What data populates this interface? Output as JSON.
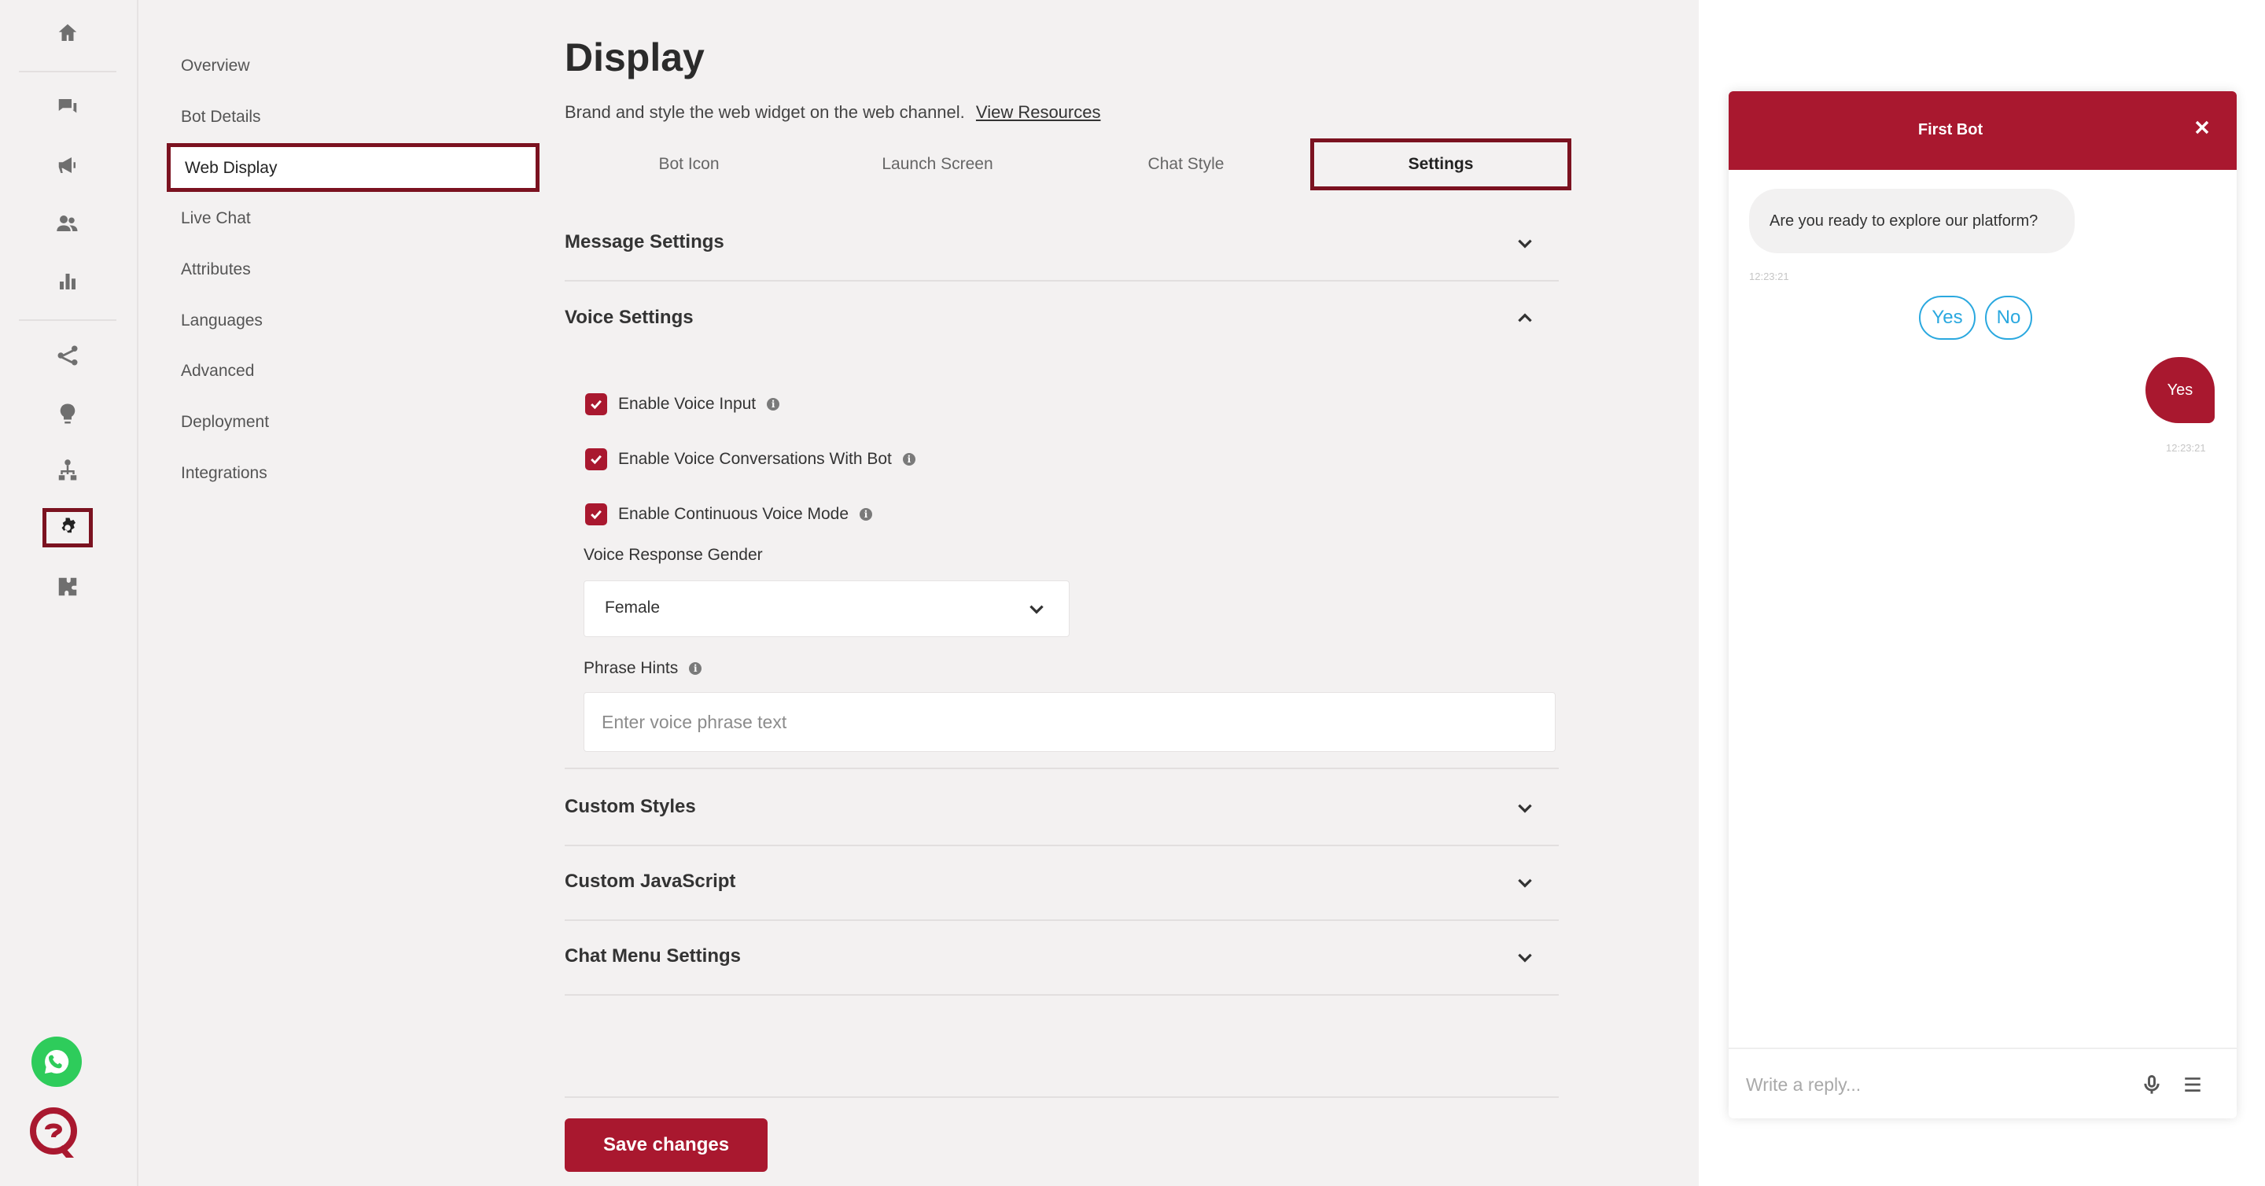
{
  "rail": {
    "icons": [
      "home-icon",
      "chat-icon",
      "megaphone-icon",
      "users-icon",
      "bar-chart-icon",
      "flow-icon",
      "lightbulb-icon",
      "hierarchy-icon",
      "gear-icon",
      "puzzle-icon"
    ],
    "active": "gear-icon"
  },
  "subnav": {
    "items": [
      "Overview",
      "Bot Details",
      "Web Display",
      "Live Chat",
      "Attributes",
      "Languages",
      "Advanced",
      "Deployment",
      "Integrations"
    ],
    "active": "Web Display"
  },
  "page": {
    "title": "Display",
    "subtitle": "Brand and style the web widget on the web channel.",
    "resources_link": "View Resources"
  },
  "tabs": [
    "Bot Icon",
    "Launch Screen",
    "Chat Style",
    "Settings"
  ],
  "active_tab": "Settings",
  "sections": {
    "message": "Message Settings",
    "voice": "Voice Settings",
    "custom_styles": "Custom Styles",
    "custom_js": "Custom JavaScript",
    "chat_menu": "Chat Menu Settings"
  },
  "voice": {
    "enable_voice_input": "Enable Voice Input",
    "enable_voice_conversations": "Enable Voice Conversations With Bot",
    "enable_continuous": "Enable Continuous Voice Mode",
    "gender_label": "Voice Response Gender",
    "gender_value": "Female",
    "phrase_label": "Phrase Hints",
    "phrase_placeholder": "Enter voice phrase text"
  },
  "save_label": "Save changes",
  "preview": {
    "title": "First Bot",
    "bot_message": "Are you ready to explore our platform?",
    "bot_time": "12:23:21",
    "quick_replies": [
      "Yes",
      "No"
    ],
    "user_message": "Yes",
    "user_time": "12:23:21",
    "input_placeholder": "Write a reply..."
  },
  "colors": {
    "brand": "#a9182f",
    "highlight_border": "#7b1220",
    "quick_reply": "#2aa8df",
    "whatsapp": "#2ecc5b"
  }
}
